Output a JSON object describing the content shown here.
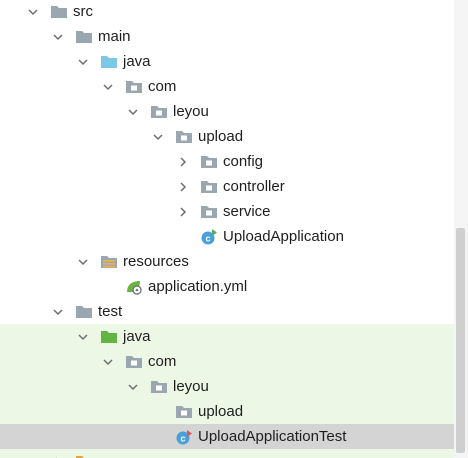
{
  "colors": {
    "test_source_bg": "#edf7e6",
    "selection_bg": "#d4d4d4",
    "scroll_track": "#f5f5f5",
    "scroll_thumb": "#cfcfcf"
  },
  "tree": [
    {
      "label": "src",
      "indent": 0,
      "chevron": "down",
      "icon": "folder-gray"
    },
    {
      "label": "main",
      "indent": 1,
      "chevron": "down",
      "icon": "folder-gray"
    },
    {
      "label": "java",
      "indent": 2,
      "chevron": "down",
      "icon": "folder-source"
    },
    {
      "label": "com",
      "indent": 3,
      "chevron": "down",
      "icon": "package"
    },
    {
      "label": "leyou",
      "indent": 4,
      "chevron": "down",
      "icon": "package"
    },
    {
      "label": "upload",
      "indent": 5,
      "chevron": "down",
      "icon": "package"
    },
    {
      "label": "config",
      "indent": 6,
      "chevron": "right",
      "icon": "package"
    },
    {
      "label": "controller",
      "indent": 6,
      "chevron": "right",
      "icon": "package"
    },
    {
      "label": "service",
      "indent": 6,
      "chevron": "right",
      "icon": "package"
    },
    {
      "label": "UploadApplication",
      "indent": 6,
      "chevron": "none",
      "icon": "spring-class"
    },
    {
      "label": "resources",
      "indent": 2,
      "chevron": "down",
      "icon": "folder-resources"
    },
    {
      "label": "application.yml",
      "indent": 3,
      "chevron": "none",
      "icon": "spring-yml"
    },
    {
      "label": "test",
      "indent": 1,
      "chevron": "down",
      "icon": "folder-gray"
    },
    {
      "label": "java",
      "indent": 2,
      "chevron": "down",
      "icon": "folder-test"
    },
    {
      "label": "com",
      "indent": 3,
      "chevron": "down",
      "icon": "package"
    },
    {
      "label": "leyou",
      "indent": 4,
      "chevron": "down",
      "icon": "package"
    },
    {
      "label": "upload",
      "indent": 5,
      "chevron": "none",
      "icon": "package"
    },
    {
      "label": "UploadApplicationTest",
      "indent": 5,
      "chevron": "none",
      "icon": "spring-test-class",
      "selected": true
    },
    {
      "label": "",
      "indent": 1,
      "chevron": "right",
      "icon": "folder-orange",
      "partial": true
    }
  ]
}
